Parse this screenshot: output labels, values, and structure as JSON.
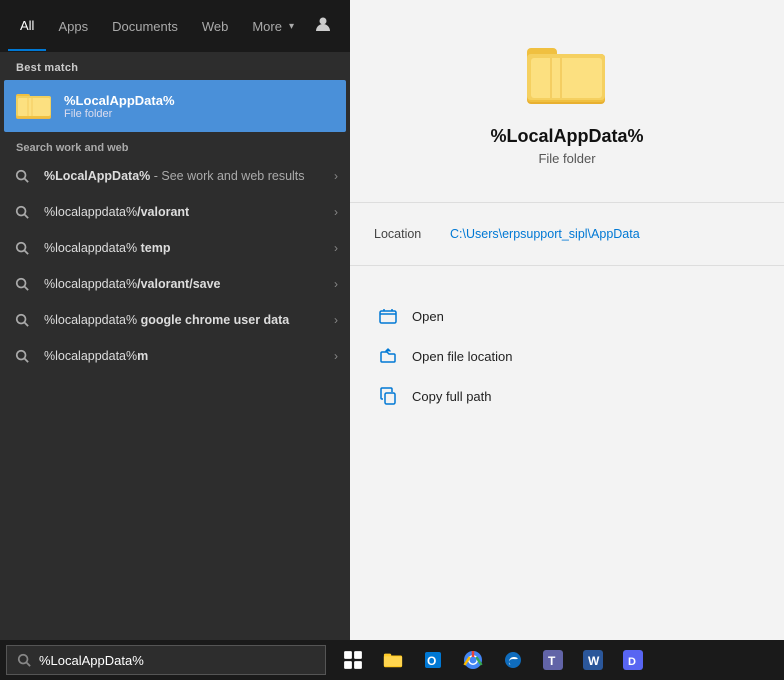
{
  "tabs": {
    "items": [
      {
        "label": "All",
        "active": true
      },
      {
        "label": "Apps",
        "active": false
      },
      {
        "label": "Documents",
        "active": false
      },
      {
        "label": "Web",
        "active": false
      },
      {
        "label": "More",
        "active": false,
        "hasArrow": true
      }
    ],
    "icon_account": "👤",
    "icon_more": "⋯"
  },
  "best_match": {
    "section_label": "Best match",
    "item_name": "%LocalAppData%",
    "item_type": "File folder",
    "folder_color": "#f0c040"
  },
  "search_web": {
    "section_label": "Search work and web",
    "items": [
      {
        "text_plain": "%LocalAppData%",
        "text_emphasis": "",
        "text_suffix": " - See work and web results",
        "has_arrow": true
      },
      {
        "text_plain": "%localappdata%",
        "text_emphasis": "/valorant",
        "text_suffix": "",
        "has_arrow": true
      },
      {
        "text_plain": "%localappdata%",
        "text_emphasis": " temp",
        "text_suffix": "",
        "has_arrow": true
      },
      {
        "text_plain": "%localappdata%",
        "text_emphasis": "/valorant/save",
        "text_suffix": "",
        "has_arrow": true
      },
      {
        "text_plain": "%localappdata%",
        "text_emphasis": " google chrome user data",
        "text_suffix": "",
        "has_arrow": true
      },
      {
        "text_plain": "%localappdata%",
        "text_emphasis": "m",
        "text_suffix": "",
        "has_arrow": true
      }
    ]
  },
  "detail": {
    "title": "%LocalAppData%",
    "subtitle": "File folder",
    "location_label": "Location",
    "location_value": "C:\\Users\\erpsupport_sipl\\AppData",
    "actions": [
      {
        "label": "Open",
        "icon_type": "folder-open"
      },
      {
        "label": "Open file location",
        "icon_type": "folder-pin"
      },
      {
        "label": "Copy full path",
        "icon_type": "copy"
      }
    ]
  },
  "taskbar": {
    "search_value": "%LocalAppData%",
    "search_placeholder": "%LocalAppData%",
    "apps": [
      {
        "name": "search",
        "icon": "⊙"
      },
      {
        "name": "task-view",
        "icon": "⧉"
      },
      {
        "name": "file-explorer",
        "icon": "📁"
      },
      {
        "name": "outlook",
        "icon": "📧"
      },
      {
        "name": "chrome",
        "icon": "🌐"
      },
      {
        "name": "edge",
        "icon": "🌊"
      },
      {
        "name": "teams",
        "icon": "T"
      },
      {
        "name": "word",
        "icon": "W"
      },
      {
        "name": "discord",
        "icon": "D"
      }
    ]
  }
}
